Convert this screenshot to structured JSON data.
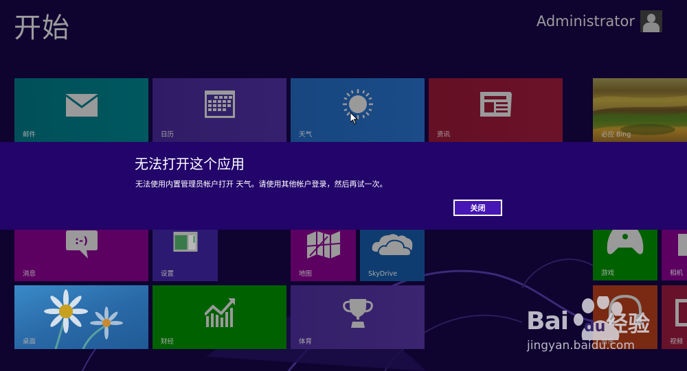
{
  "header": {
    "title": "开始",
    "user_name": "Administrator"
  },
  "tiles": [
    {
      "label": "邮件",
      "icon": "mail-icon",
      "color": "#00535e"
    },
    {
      "label": "日历",
      "icon": "calendar-icon",
      "color": "#32206a"
    },
    {
      "label": "天气",
      "icon": "sun-icon",
      "color": "#194a85"
    },
    {
      "label": "资讯",
      "icon": "news-icon",
      "color": "#671226"
    },
    {
      "label": "必应 Bing",
      "icon": "landscape-image",
      "color": "#6a5a20"
    },
    {
      "label": "消息",
      "icon": "chat-smiley-icon",
      "color": "#5c0062"
    },
    {
      "label": "设置",
      "icon": "pc-settings-icon",
      "color": "#2c1a72"
    },
    {
      "label": "地图",
      "icon": "map-icon",
      "color": "#5c0062"
    },
    {
      "label": "SkyDrive",
      "icon": "cloud-icon",
      "color": "#0f3c70"
    },
    {
      "label": "游戏",
      "icon": "gamepad-icon",
      "color": "#006100"
    },
    {
      "label": "相机",
      "icon": "camera-icon",
      "color": "#5c0062"
    },
    {
      "label": "桌面",
      "icon": "daisy-image",
      "color": "#2d6aa0"
    },
    {
      "label": "财经",
      "icon": "chart-up-icon",
      "color": "#006100"
    },
    {
      "label": "体育",
      "icon": "trophy-icon",
      "color": "#39236c"
    },
    {
      "label": "音乐",
      "icon": "headphones-icon",
      "color": "#7a2a12"
    },
    {
      "label": "视频",
      "icon": "video-icon",
      "color": "#67112a"
    }
  ],
  "dialog": {
    "title": "无法打开这个应用",
    "message": "无法使用内置管理员帐户打开 天气。请使用其他帐户登录，然后再试一次。",
    "close_label": "关闭",
    "background": "#22046a"
  },
  "watermark": {
    "brand": "Bai",
    "brand_du": "du",
    "product": "经验",
    "url": "jingyan.baidu.com"
  }
}
